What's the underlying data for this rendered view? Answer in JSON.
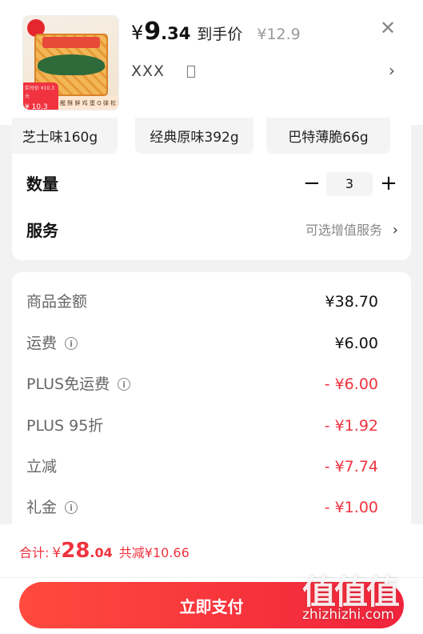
{
  "product": {
    "thumb_tag_top": "实付价 ¥10.3 元",
    "thumb_tag_price": "¥ 10.3 元",
    "thumb_strip_text": "醒 酥 鲜 鸡 蛋  Q 弹 松 软",
    "currency": "¥",
    "price_int": "9",
    "price_dec": ".34",
    "price_label": "到手价",
    "original_price": "¥12.9",
    "close_icon": "close-icon",
    "spec_text": "XXX",
    "spec_chevron": "›"
  },
  "options": {
    "chips": [
      "芝士味160g",
      "经典原味392g",
      "巴特薄脆66g"
    ]
  },
  "quantity": {
    "label": "数量",
    "minus": "−",
    "value": "3",
    "plus": "+"
  },
  "service": {
    "label": "服务",
    "value": "可选增值服务",
    "chevron": "›"
  },
  "summary": {
    "rows": [
      {
        "label": "商品金额",
        "value": "¥38.70",
        "info": false,
        "discount": false
      },
      {
        "label": "运费",
        "value": "¥6.00",
        "info": true,
        "discount": false
      },
      {
        "label": "PLUS免运费",
        "value": "- ¥6.00",
        "info": true,
        "discount": true
      },
      {
        "label": "PLUS 95折",
        "value": "- ¥1.92",
        "info": false,
        "discount": true
      },
      {
        "label": "立减",
        "value": "- ¥7.74",
        "info": false,
        "discount": true
      },
      {
        "label": "礼金",
        "value": "- ¥1.00",
        "info": true,
        "discount": true
      }
    ],
    "info_glyph": "i"
  },
  "total": {
    "label": "合计:",
    "currency": "¥",
    "int": "28",
    "dec": ".04",
    "saved": "共减¥10.66"
  },
  "pay_button": "立即支付",
  "watermark": {
    "glyphs": "值值值",
    "url": "zhizhizhi.com"
  },
  "colors": {
    "accent_red": "#f0333f",
    "button_gradient_start": "#ff4a3e",
    "button_gradient_end": "#f0233b"
  }
}
